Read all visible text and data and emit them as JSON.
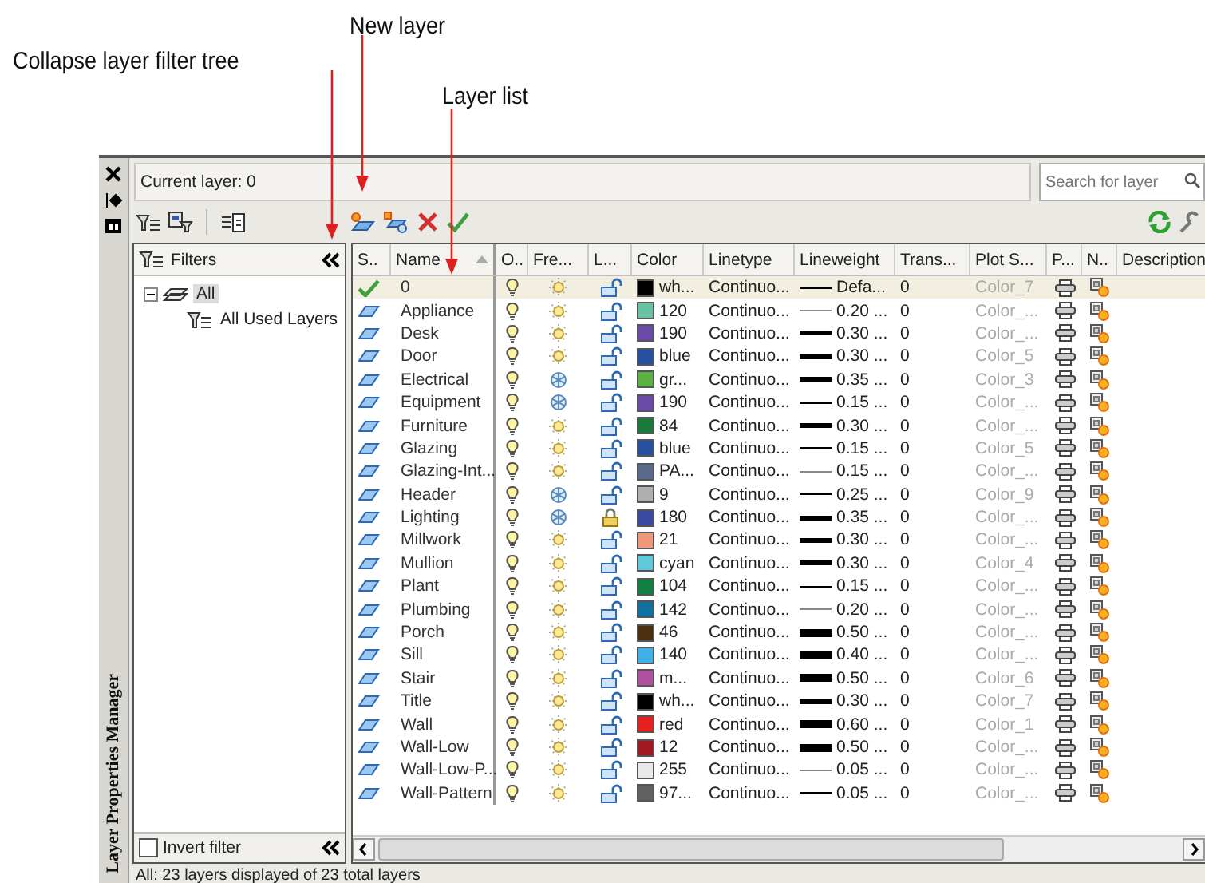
{
  "annotations": [
    {
      "text": "Collapse layer filter tree"
    },
    {
      "text": "New layer"
    },
    {
      "text": "Layer list"
    }
  ],
  "palette": {
    "title": "Layer Properties Manager"
  },
  "current_layer": "Current layer: 0",
  "search": {
    "placeholder": "Search for layer"
  },
  "filters": {
    "title": "Filters",
    "tree": [
      {
        "label": "All",
        "selected": true,
        "expanded": true,
        "children": [
          {
            "label": "All Used Layers",
            "selected": false
          }
        ]
      }
    ],
    "invert": {
      "label": "Invert filter",
      "checked": false
    }
  },
  "table": {
    "columns": [
      "S..",
      "Name",
      "O..",
      "Fre...",
      "L...",
      "Color",
      "Linetype",
      "Lineweight",
      "Trans...",
      "Plot S...",
      "P...",
      "N..",
      "Description"
    ],
    "rows": [
      {
        "current": true,
        "selected": true,
        "name": "0",
        "on": true,
        "frozen": false,
        "locked": false,
        "color": "#000000",
        "color_name": "wh...",
        "linetype": "Continuo...",
        "kind": "thin",
        "lineweight": "Defa...",
        "transparency": "0",
        "plot_style": "Color_7"
      },
      {
        "current": false,
        "selected": false,
        "name": "Appliance",
        "on": true,
        "frozen": false,
        "locked": false,
        "color": "#66c2a0",
        "color_name": "120",
        "linetype": "Continuo...",
        "kind": "hair",
        "lineweight": "0.20 ...",
        "transparency": "0",
        "plot_style": "Color_..."
      },
      {
        "current": false,
        "selected": false,
        "name": "Desk",
        "on": true,
        "frozen": false,
        "locked": false,
        "color": "#6a4aa8",
        "color_name": "190",
        "linetype": "Continuo...",
        "kind": "bold",
        "lineweight": "0.30 ...",
        "transparency": "0",
        "plot_style": "Color_..."
      },
      {
        "current": false,
        "selected": false,
        "name": "Door",
        "on": true,
        "frozen": false,
        "locked": false,
        "color": "#2850a0",
        "color_name": "blue",
        "linetype": "Continuo...",
        "kind": "bold",
        "lineweight": "0.30 ...",
        "transparency": "0",
        "plot_style": "Color_5"
      },
      {
        "current": false,
        "selected": false,
        "name": "Electrical",
        "on": true,
        "frozen": true,
        "locked": false,
        "color": "#5ab040",
        "color_name": "gr...",
        "linetype": "Continuo...",
        "kind": "bold",
        "lineweight": "0.35 ...",
        "transparency": "0",
        "plot_style": "Color_3"
      },
      {
        "current": false,
        "selected": false,
        "name": "Equipment",
        "on": true,
        "frozen": true,
        "locked": false,
        "color": "#6a4aa8",
        "color_name": "190",
        "linetype": "Continuo...",
        "kind": "thin",
        "lineweight": "0.15 ...",
        "transparency": "0",
        "plot_style": "Color_..."
      },
      {
        "current": false,
        "selected": false,
        "name": "Furniture",
        "on": true,
        "frozen": false,
        "locked": false,
        "color": "#1a7a3a",
        "color_name": "84",
        "linetype": "Continuo...",
        "kind": "bold",
        "lineweight": "0.30 ...",
        "transparency": "0",
        "plot_style": "Color_..."
      },
      {
        "current": false,
        "selected": false,
        "name": "Glazing",
        "on": true,
        "frozen": false,
        "locked": false,
        "color": "#2850a0",
        "color_name": "blue",
        "linetype": "Continuo...",
        "kind": "thin",
        "lineweight": "0.15 ...",
        "transparency": "0",
        "plot_style": "Color_5"
      },
      {
        "current": false,
        "selected": false,
        "name": "Glazing-Int...",
        "on": true,
        "frozen": false,
        "locked": false,
        "color": "#5a6a8a",
        "color_name": "PA...",
        "linetype": "Continuo...",
        "kind": "hair",
        "lineweight": "0.15 ...",
        "transparency": "0",
        "plot_style": "Color_..."
      },
      {
        "current": false,
        "selected": false,
        "name": "Header",
        "on": true,
        "frozen": true,
        "locked": false,
        "color": "#b0b0b0",
        "color_name": "9",
        "linetype": "Continuo...",
        "kind": "thin",
        "lineweight": "0.25 ...",
        "transparency": "0",
        "plot_style": "Color_9"
      },
      {
        "current": false,
        "selected": false,
        "name": "Lighting",
        "on": true,
        "frozen": true,
        "locked": true,
        "color": "#3a4aa0",
        "color_name": "180",
        "linetype": "Continuo...",
        "kind": "bold",
        "lineweight": "0.35 ...",
        "transparency": "0",
        "plot_style": "Color_..."
      },
      {
        "current": false,
        "selected": false,
        "name": "Millwork",
        "on": true,
        "frozen": false,
        "locked": false,
        "color": "#f0967a",
        "color_name": "21",
        "linetype": "Continuo...",
        "kind": "bold",
        "lineweight": "0.30 ...",
        "transparency": "0",
        "plot_style": "Color_..."
      },
      {
        "current": false,
        "selected": false,
        "name": "Mullion",
        "on": true,
        "frozen": false,
        "locked": false,
        "color": "#60c8d8",
        "color_name": "cyan",
        "linetype": "Continuo...",
        "kind": "bold",
        "lineweight": "0.30 ...",
        "transparency": "0",
        "plot_style": "Color_4"
      },
      {
        "current": false,
        "selected": false,
        "name": "Plant",
        "on": true,
        "frozen": false,
        "locked": false,
        "color": "#108040",
        "color_name": "104",
        "linetype": "Continuo...",
        "kind": "thin",
        "lineweight": "0.15 ...",
        "transparency": "0",
        "plot_style": "Color_..."
      },
      {
        "current": false,
        "selected": false,
        "name": "Plumbing",
        "on": true,
        "frozen": false,
        "locked": false,
        "color": "#1070a0",
        "color_name": "142",
        "linetype": "Continuo...",
        "kind": "hair",
        "lineweight": "0.20 ...",
        "transparency": "0",
        "plot_style": "Color_..."
      },
      {
        "current": false,
        "selected": false,
        "name": "Porch",
        "on": true,
        "frozen": false,
        "locked": false,
        "color": "#4a3010",
        "color_name": "46",
        "linetype": "Continuo...",
        "kind": "heavy",
        "lineweight": "0.50 ...",
        "transparency": "0",
        "plot_style": "Color_..."
      },
      {
        "current": false,
        "selected": false,
        "name": "Sill",
        "on": true,
        "frozen": false,
        "locked": false,
        "color": "#40b0e8",
        "color_name": "140",
        "linetype": "Continuo...",
        "kind": "heavy",
        "lineweight": "0.40 ...",
        "transparency": "0",
        "plot_style": "Color_..."
      },
      {
        "current": false,
        "selected": false,
        "name": "Stair",
        "on": true,
        "frozen": false,
        "locked": false,
        "color": "#b050a0",
        "color_name": "m...",
        "linetype": "Continuo...",
        "kind": "heavy",
        "lineweight": "0.50 ...",
        "transparency": "0",
        "plot_style": "Color_6"
      },
      {
        "current": false,
        "selected": false,
        "name": "Title",
        "on": true,
        "frozen": false,
        "locked": false,
        "color": "#000000",
        "color_name": "wh...",
        "linetype": "Continuo...",
        "kind": "bold",
        "lineweight": "0.30 ...",
        "transparency": "0",
        "plot_style": "Color_7"
      },
      {
        "current": false,
        "selected": false,
        "name": "Wall",
        "on": true,
        "frozen": false,
        "locked": false,
        "color": "#e82020",
        "color_name": "red",
        "linetype": "Continuo...",
        "kind": "heavy",
        "lineweight": "0.60 ...",
        "transparency": "0",
        "plot_style": "Color_1"
      },
      {
        "current": false,
        "selected": false,
        "name": "Wall-Low",
        "on": true,
        "frozen": false,
        "locked": false,
        "color": "#a01820",
        "color_name": "12",
        "linetype": "Continuo...",
        "kind": "heavy",
        "lineweight": "0.50 ...",
        "transparency": "0",
        "plot_style": "Color_..."
      },
      {
        "current": false,
        "selected": false,
        "name": "Wall-Low-P...",
        "on": true,
        "frozen": false,
        "locked": false,
        "color": "#e8e8e8",
        "color_name": "255",
        "linetype": "Continuo...",
        "kind": "hair",
        "lineweight": "0.05 ...",
        "transparency": "0",
        "plot_style": "Color_..."
      },
      {
        "current": false,
        "selected": false,
        "name": "Wall-Pattern",
        "on": true,
        "frozen": false,
        "locked": false,
        "color": "#606060",
        "color_name": "97...",
        "linetype": "Continuo...",
        "kind": "thin",
        "lineweight": "0.05 ...",
        "transparency": "0",
        "plot_style": "Color_..."
      }
    ]
  },
  "status_bar": "All: 23 layers displayed of 23 total layers"
}
